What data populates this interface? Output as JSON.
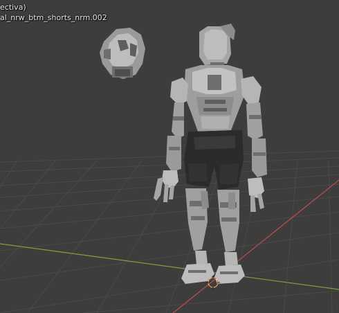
{
  "viewport": {
    "view_mode_label": "ectiva)",
    "object_label": "al_nrw_btm_shorts_nrm.002"
  },
  "colors": {
    "background": "#3d3d3d",
    "grid_line": "#4a4a4a",
    "x_axis": "#c34b4b",
    "y_axis": "#7da33c",
    "model_light": "#bdbdbd",
    "model_mid": "#8c8c8c",
    "model_dark": "#5e5e5e",
    "shorts": "#2b2b2b",
    "origin_marker": "#e07a3a"
  }
}
